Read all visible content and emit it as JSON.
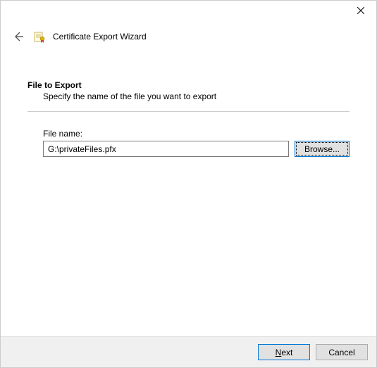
{
  "window": {
    "title": "Certificate Export Wizard"
  },
  "page": {
    "heading": "File to Export",
    "subheading": "Specify the name of the file you want to export"
  },
  "form": {
    "filename_label": "File name:",
    "filename_value": "G:\\privateFiles.pfx",
    "browse_label": "Browse..."
  },
  "footer": {
    "next_label": "Next",
    "cancel_label": "Cancel"
  }
}
